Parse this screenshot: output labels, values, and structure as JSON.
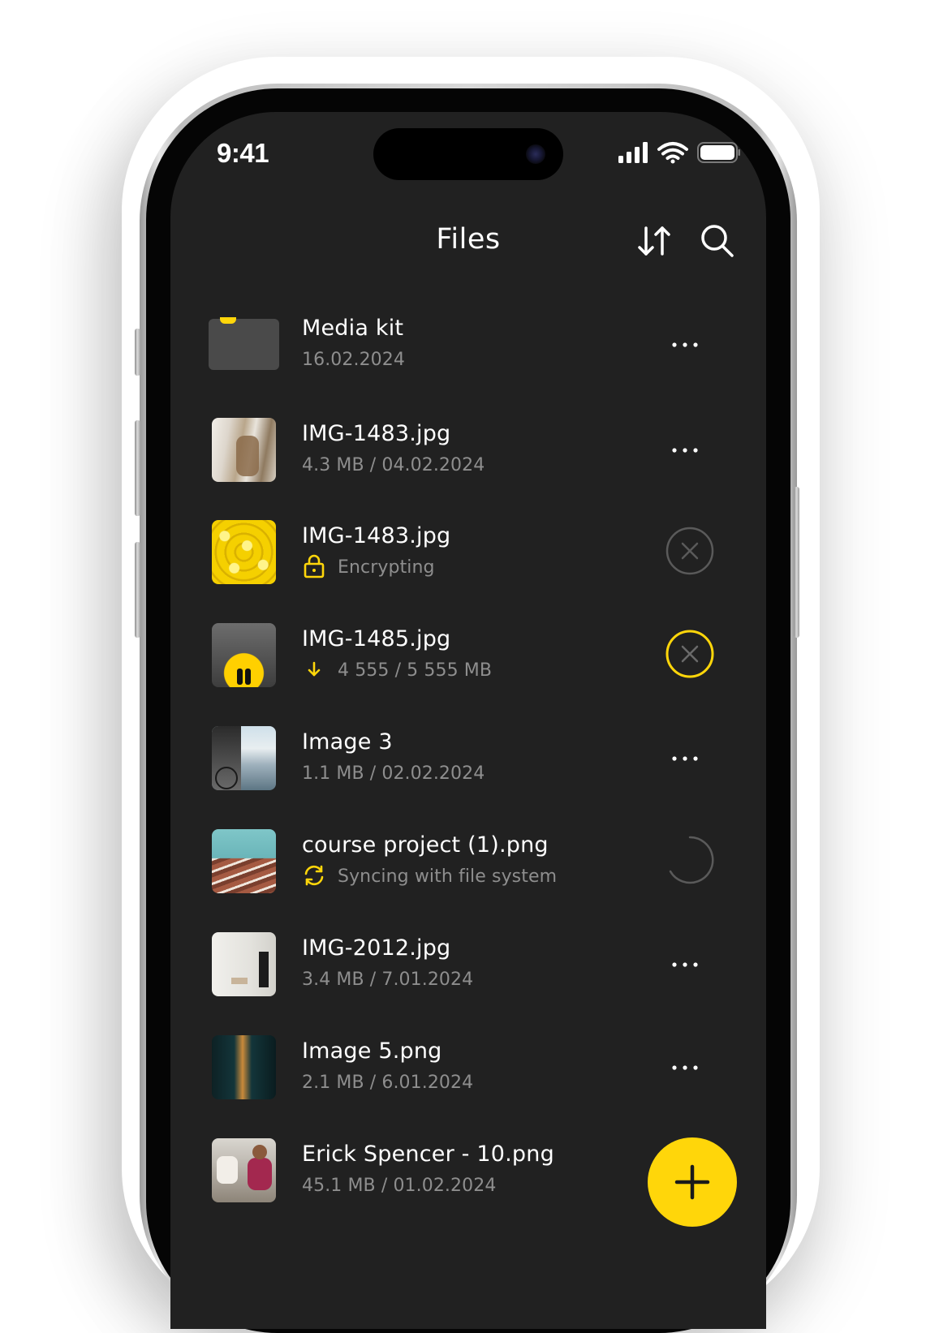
{
  "status_bar": {
    "time": "9:41"
  },
  "header": {
    "title": "Files"
  },
  "files": [
    {
      "name": "Media kit",
      "meta": "16.02.2024",
      "type": "folder",
      "action": "more"
    },
    {
      "name": "IMG-1483.jpg",
      "meta": "4.3 MB / 04.02.2024",
      "type": "image",
      "action": "more"
    },
    {
      "name": "IMG-1483.jpg",
      "meta": "Encrypting",
      "type": "image",
      "status_icon": "lock-icon",
      "action": "cancel"
    },
    {
      "name": "IMG-1485.jpg",
      "meta": "4 555 / 5 555 MB",
      "type": "image",
      "status_icon": "download-arrow-icon",
      "action": "cancel-active"
    },
    {
      "name": "Image 3",
      "meta": "1.1 MB / 02.02.2024",
      "type": "image",
      "action": "more"
    },
    {
      "name": "course project (1).png",
      "meta": "Syncing with file system",
      "type": "image",
      "status_icon": "sync-icon",
      "action": "spinner"
    },
    {
      "name": "IMG-2012.jpg",
      "meta": "3.4 MB / 7.01.2024",
      "type": "image",
      "action": "more"
    },
    {
      "name": "Image 5.png",
      "meta": "2.1 MB / 6.01.2024",
      "type": "image",
      "action": "more"
    },
    {
      "name": "Erick Spencer - 10.png",
      "meta": "45.1 MB / 01.02.2024",
      "type": "image",
      "action": "none"
    }
  ],
  "colors": {
    "accent": "#ffd60a",
    "background": "#212121",
    "text": "#ffffff",
    "muted": "#8e8e8e"
  },
  "fab": {
    "icon": "plus-icon"
  }
}
